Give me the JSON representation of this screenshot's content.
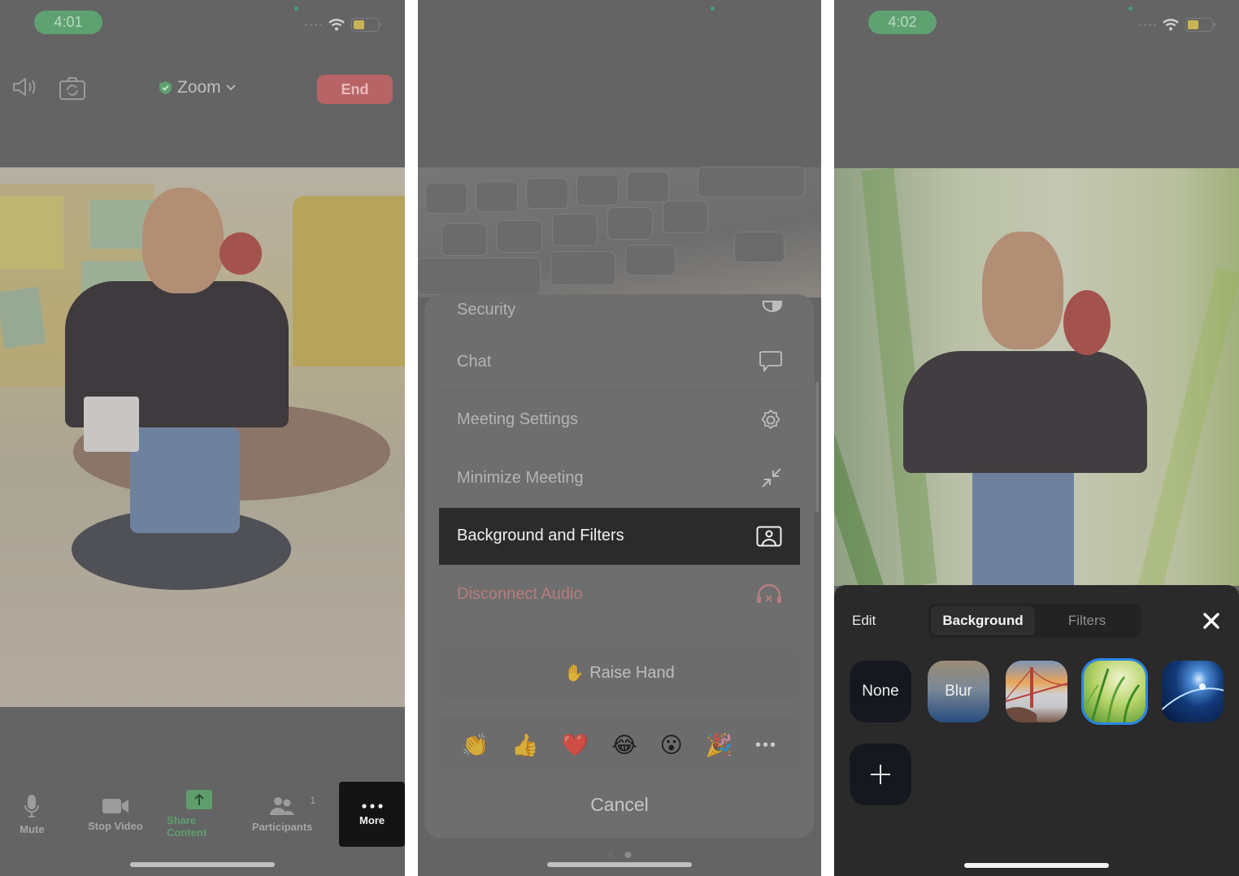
{
  "panels": [
    {
      "status_bar": {
        "time": "4:01"
      },
      "header": {
        "meeting_title": "Zoom",
        "end_label": "End"
      },
      "toolbar": {
        "items": [
          {
            "label": "Mute",
            "icon": "microphone-icon"
          },
          {
            "label": "Stop Video",
            "icon": "video-camera-icon"
          },
          {
            "label": "Share Content",
            "icon": "share-screen-icon"
          },
          {
            "label": "Participants",
            "icon": "participants-icon",
            "badge": "1"
          },
          {
            "label": "More",
            "icon": "more-dots-icon",
            "active": true
          }
        ]
      }
    },
    {
      "menu": {
        "items": [
          {
            "label": "Security",
            "icon": "shield-icon"
          },
          {
            "label": "Chat",
            "icon": "chat-bubble-icon"
          },
          {
            "label": "Meeting Settings",
            "icon": "gear-icon"
          },
          {
            "label": "Minimize Meeting",
            "icon": "minimize-arrows-icon"
          },
          {
            "label": "Background and Filters",
            "icon": "background-person-icon",
            "active": true
          },
          {
            "label": "Disconnect Audio",
            "icon": "headphones-disconnect-icon",
            "danger": true
          }
        ],
        "raise_hand": {
          "emoji": "✋",
          "label": "Raise Hand"
        },
        "reactions": [
          "👏",
          "👍",
          "❤️",
          "😂",
          "😮",
          "🎉"
        ],
        "more_reactions": "•••",
        "cancel_label": "Cancel",
        "page_indicator": {
          "pages": 2,
          "current": 2
        }
      }
    },
    {
      "status_bar": {
        "time": "4:02"
      },
      "background_filters": {
        "edit_label": "Edit",
        "tabs": [
          {
            "label": "Background",
            "active": true
          },
          {
            "label": "Filters",
            "active": false
          }
        ],
        "options": [
          {
            "label": "None",
            "kind": "none"
          },
          {
            "label": "Blur",
            "kind": "blur"
          },
          {
            "label": "",
            "kind": "golden-gate-bridge"
          },
          {
            "label": "",
            "kind": "grass",
            "selected": true
          },
          {
            "label": "",
            "kind": "earth-from-space"
          }
        ],
        "add_label": "+"
      }
    }
  ],
  "colors": {
    "accent_green": "#5fa272",
    "end_red": "#b86466",
    "selection_blue": "#2a85e8",
    "danger_text": "#b67d7e"
  }
}
